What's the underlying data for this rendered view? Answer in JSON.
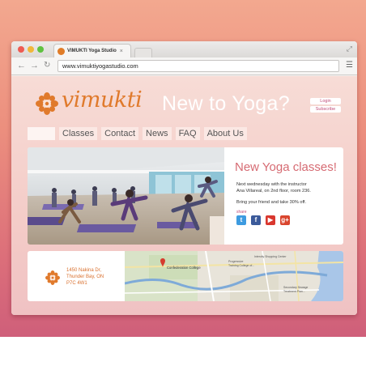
{
  "browser": {
    "tab_title": "VIMUKTI Yoga Studio",
    "tab_close": "×",
    "url": "www.vimuktiyogastudio.com"
  },
  "site": {
    "logo_text": "vimukti",
    "hero_title": "New to Yoga?",
    "login_label": "Login",
    "subscribe_label": "Subscribe",
    "nav": [
      "",
      "Classes",
      "Contact",
      "News",
      "FAQ",
      "About Us"
    ]
  },
  "promo": {
    "title": "New Yoga classes!",
    "line1": "Next wednesday with the instructor",
    "line2": "Ana Villareal, on 2nd floor, room 236.",
    "line3": "Bring your friend and take 30% off.",
    "share_label": "share",
    "social": [
      {
        "icon": "twitter-icon",
        "glyph": "t",
        "color": "#3d9be0"
      },
      {
        "icon": "facebook-icon",
        "glyph": "f",
        "color": "#3b5a9a"
      },
      {
        "icon": "youtube-icon",
        "glyph": "▶",
        "color": "#d9372e"
      },
      {
        "icon": "google-plus-icon",
        "glyph": "g+",
        "color": "#d9452e"
      }
    ]
  },
  "contact": {
    "address_line1": "1450 Nakina Dr,",
    "address_line2": "Thunder Bay, ON",
    "address_line3": "P7C 4W1"
  },
  "map": {
    "pin_label": "Confederation College",
    "label_progressive": "Progressive",
    "label_training": "Training College of...",
    "label_shopping": "Intercity Shopping Center",
    "label_sewage": "Secondary Sewage",
    "label_treatment": "Treatment Plan..."
  },
  "colors": {
    "brand_orange": "#e07a2c",
    "accent_pink": "#c04c78",
    "promo_title": "#d66b73"
  }
}
